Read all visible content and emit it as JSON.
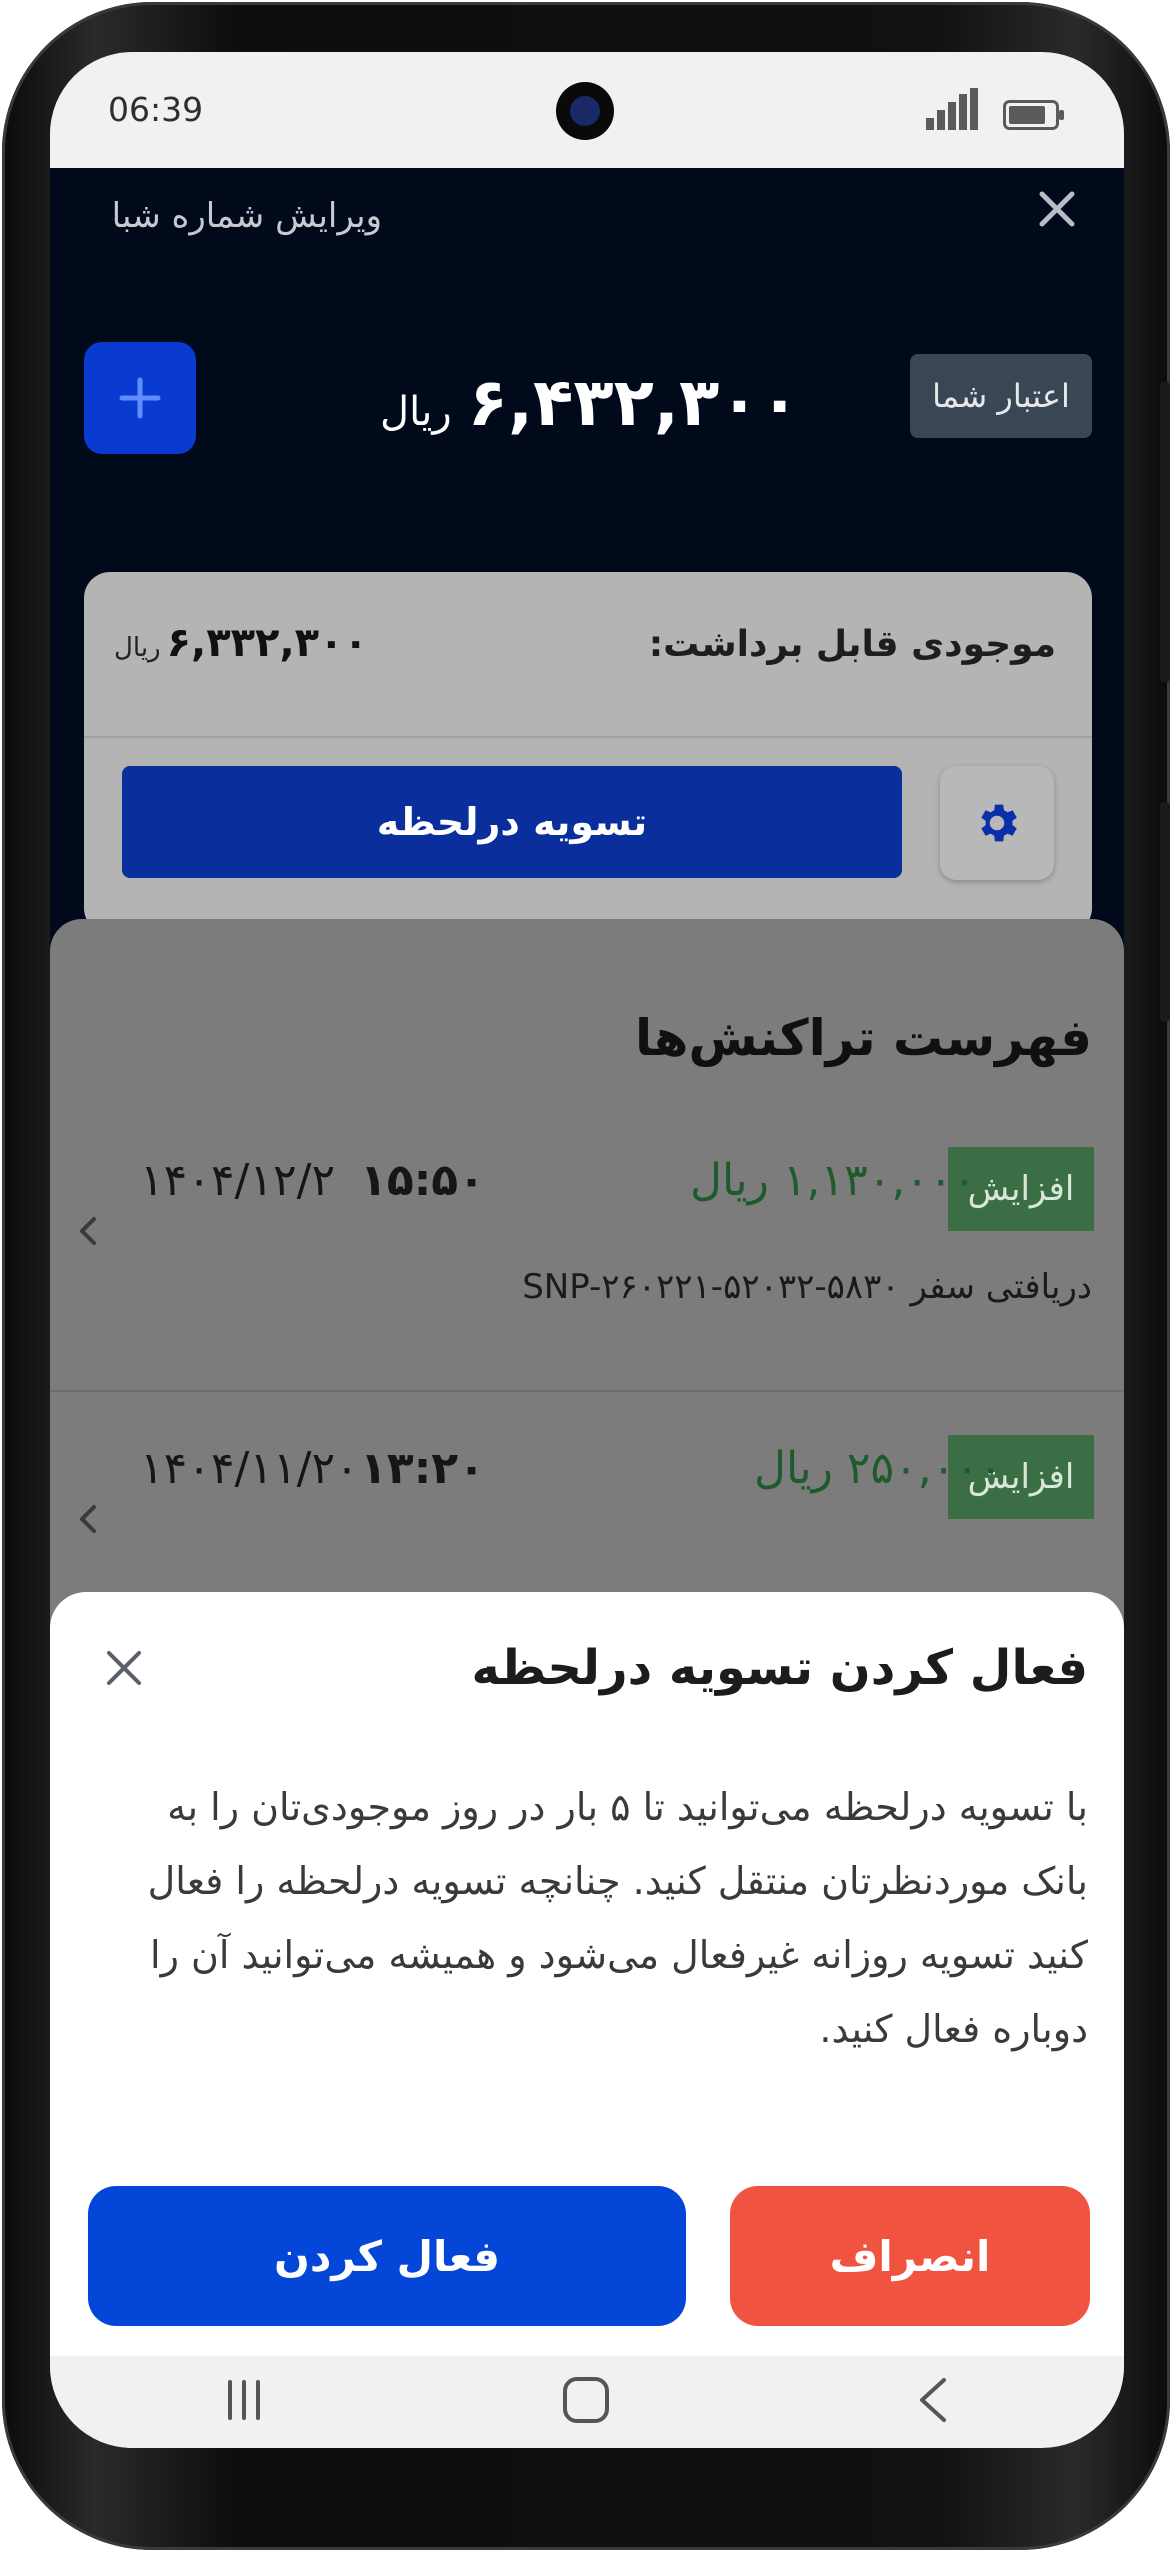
{
  "status_bar": {
    "time": "06:39",
    "signal_icon": "signal-bars-icon",
    "battery_icon": "battery-icon"
  },
  "header": {
    "edit_sheba_link": "ویرایش شماره شبا",
    "close_icon": "close-icon"
  },
  "credit": {
    "label": "اعتبار شما",
    "amount": "۶,۴۳۲,۳۰۰",
    "unit": "ریال",
    "add_icon": "plus-icon"
  },
  "withdrawable": {
    "label": "موجودی قابل برداشت:",
    "amount": "۶,۳۳۲,۳۰۰",
    "unit": "ریال",
    "instant_settlement_button": "تسویه درلحظه",
    "settings_icon": "gear-icon"
  },
  "transactions": {
    "title": "فهرست تراکنش‌ها",
    "items": [
      {
        "badge": "افزایش",
        "amount": "۱,۱۳۰,۰۰۰ ریال",
        "time": "۱۵:۵۰",
        "date": "۱۴۰۴/۱۲/۲",
        "description": "دریافتی سفر SNP-۲۶۰۲۲۱-۵۲۰۳۲-۵۸۳۰"
      },
      {
        "badge": "افزایش",
        "amount": "۲۵۰,۰۰۰ ریال",
        "time": "۱۳:۲۰",
        "date": "۱۴۰۴/۱۱/۲۰",
        "description": ""
      }
    ]
  },
  "dialog": {
    "title": "فعال کردن تسویه درلحظه",
    "body": "با تسویه درلحظه می‌توانید تا ۵ بار در روز موجودی‌تان را به بانک موردنظرتان منتقل کنید. چنانچه تسویه درلحظه را فعال کنید تسویه روزانه غیرفعال می‌شود و همیشه می‌توانید آن را دوباره فعال کنید.",
    "cancel_button": "انصراف",
    "activate_button": "فعال کردن",
    "close_icon": "close-icon"
  },
  "nav_bar": {
    "recent_icon": "recent-apps-icon",
    "home_icon": "home-icon",
    "back_icon": "back-icon"
  },
  "colors": {
    "primary_blue": "#0447d8",
    "danger": "#f0533f",
    "success_badge": "#3b6e45",
    "dark_bg": "#000a1a"
  }
}
